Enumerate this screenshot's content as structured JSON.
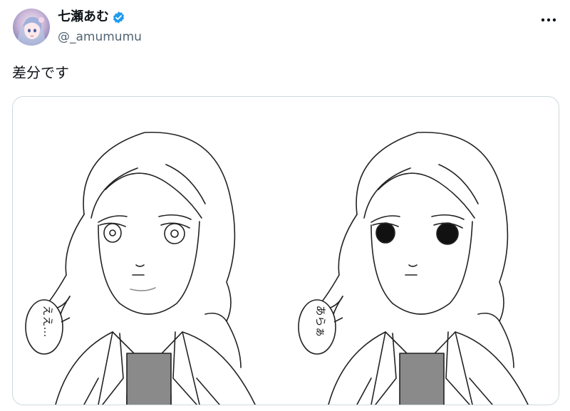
{
  "user": {
    "display_name": "七瀬あむ",
    "handle": "@_amumumu",
    "verified": true,
    "avatar_icon": "avatar-illustration",
    "verified_color": "#1d9bf0"
  },
  "more_icon": "more-horizontal-icon",
  "tweet": {
    "text": "差分です"
  },
  "media": {
    "left_bubble_text": "ええ…",
    "right_bubble_text": "あらぁ",
    "ink_color": "#222222",
    "shade_color": "#d9d9d9"
  }
}
